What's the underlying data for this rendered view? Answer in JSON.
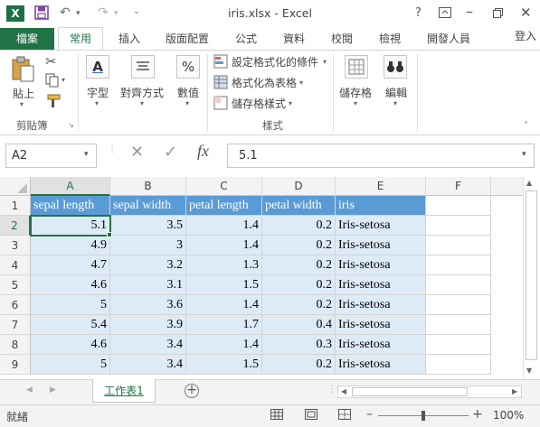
{
  "window": {
    "title": "iris.xlsx - Excel",
    "logo_letter": "X",
    "help": "?",
    "login": "登入"
  },
  "ribbon_tabs": [
    "檔案",
    "常用",
    "插入",
    "版面配置",
    "公式",
    "資料",
    "校閱",
    "檢視",
    "開發人員"
  ],
  "ribbon": {
    "paste_label": "貼上",
    "clipboard_group": "剪貼簿",
    "font_label": "字型",
    "alignment_label": "對齊方式",
    "number_label": "數值",
    "styles_group": "樣式",
    "conditional_format": "設定格式化的條件",
    "format_as_table": "格式化為表格",
    "cell_styles": "儲存格樣式",
    "cells_label": "儲存格",
    "editing_label": "編輯"
  },
  "formula_bar": {
    "name_box": "A2",
    "fx": "fx",
    "value": "5.1"
  },
  "columns": [
    "A",
    "B",
    "C",
    "D",
    "E",
    "F"
  ],
  "row_numbers": [
    "1",
    "2",
    "3",
    "4",
    "5",
    "6",
    "7",
    "8",
    "9"
  ],
  "table": {
    "headers": [
      "sepal length",
      "sepal width",
      "petal length",
      "petal width",
      "iris"
    ],
    "rows": [
      [
        "5.1",
        "3.5",
        "1.4",
        "0.2",
        "Iris-setosa"
      ],
      [
        "4.9",
        "3",
        "1.4",
        "0.2",
        "Iris-setosa"
      ],
      [
        "4.7",
        "3.2",
        "1.3",
        "0.2",
        "Iris-setosa"
      ],
      [
        "4.6",
        "3.1",
        "1.5",
        "0.2",
        "Iris-setosa"
      ],
      [
        "5",
        "3.6",
        "1.4",
        "0.2",
        "Iris-setosa"
      ],
      [
        "5.4",
        "3.9",
        "1.7",
        "0.4",
        "Iris-setosa"
      ],
      [
        "4.6",
        "3.4",
        "1.4",
        "0.3",
        "Iris-setosa"
      ],
      [
        "5",
        "3.4",
        "1.5",
        "0.2",
        "Iris-setosa"
      ]
    ]
  },
  "sheets": {
    "active": "工作表1"
  },
  "status": {
    "ready": "就緒",
    "zoom": "100%"
  },
  "colors": {
    "excel_green": "#217346",
    "table_header": "#5b9bd5",
    "table_band": "#ddebf7"
  }
}
